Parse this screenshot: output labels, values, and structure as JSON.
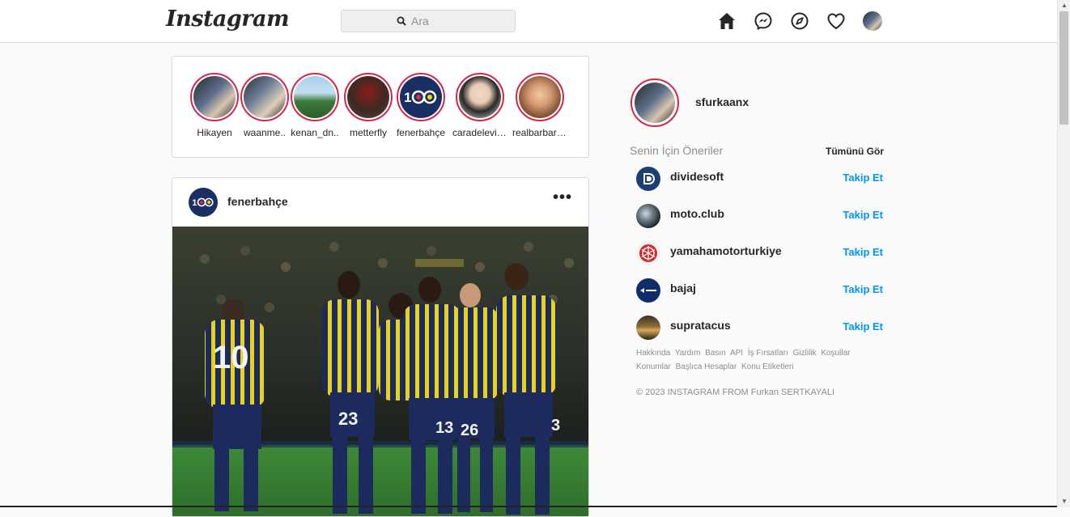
{
  "header": {
    "logo": "Instagram",
    "search_placeholder": "Ara"
  },
  "stories": [
    {
      "name": "Hikayen"
    },
    {
      "name": "waanme.."
    },
    {
      "name": "kenan_dn.."
    },
    {
      "name": "metterfly"
    },
    {
      "name": "fenerbahçe"
    },
    {
      "name": "caradelevin.."
    },
    {
      "name": "realbarbarap.."
    }
  ],
  "post": {
    "username": "fenerbahçe",
    "more": "•••",
    "avatar_text": "100"
  },
  "profile": {
    "username": "sfurkaanx"
  },
  "suggestions": {
    "title": "Senin İçin Öneriler",
    "see_all": "Tümünü Gör",
    "follow_label": "Takip Et",
    "items": [
      {
        "name": "dividesoft"
      },
      {
        "name": "moto.club"
      },
      {
        "name": "yamahamotorturkiye"
      },
      {
        "name": "bajaj"
      },
      {
        "name": "supratacus"
      }
    ]
  },
  "footer": {
    "links": [
      "Hakkında",
      "Yardım",
      "Basın",
      "API",
      "İş Fırsatları",
      "Gizlilik",
      "Koşullar",
      "Konumlar",
      "Başlıca Hesaplar",
      "Konu Etiketleri"
    ],
    "copyright": "© 2023 INSTAGRAM FROM Furkan SERTKAYALI"
  },
  "colors": {
    "accent": "#0095f6",
    "story_ring": "#d6264a",
    "border": "#dbdbdb",
    "fb_navy": "#1c2f63",
    "fb_yellow": "#f5d90a"
  }
}
